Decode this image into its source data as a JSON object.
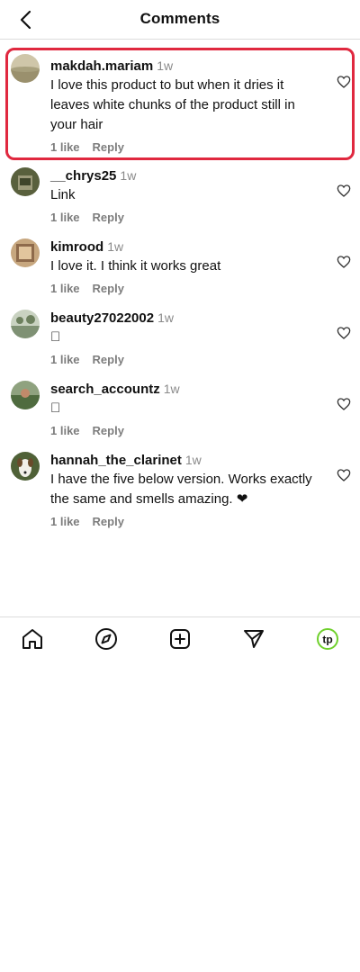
{
  "header": {
    "title": "Comments"
  },
  "comments": [
    {
      "username": "makdah.mariam",
      "time": "1w",
      "text": "I love this product to but when it dries it leaves white chunks of the product still in your hair",
      "likes": "1 like",
      "reply": "Reply",
      "highlighted": true,
      "avatar_color": "#b9ad8a"
    },
    {
      "username": "__chrys25",
      "time": "1w",
      "text": "Link",
      "likes": "1 like",
      "reply": "Reply",
      "avatar_color": "#6b6f4a"
    },
    {
      "username": "kimrood",
      "time": "1w",
      "text": "I love it. I think it works great",
      "likes": "1 like",
      "reply": "Reply",
      "avatar_color": "#b89474"
    },
    {
      "username": "beauty27022002",
      "time": "1w",
      "text": "\u0000",
      "likes": "1 like",
      "reply": "Reply",
      "avatar_color": "#9fae92"
    },
    {
      "username": "search_accountz",
      "time": "1w",
      "text": "\u0000",
      "likes": "1 like",
      "reply": "Reply",
      "avatar_color": "#6f8a63"
    },
    {
      "username": "hannah_the_clarinet",
      "time": "1w",
      "text": "I have the five below version. Works exactly the same and smells amazing. ❤",
      "likes": "1 like",
      "reply": "Reply",
      "avatar_color": "#5f7043"
    }
  ],
  "nav": {
    "items": [
      "home-icon",
      "explore-icon",
      "create-icon",
      "send-icon",
      "profile-icon"
    ],
    "profile_label": "tp",
    "accent_color": "#6fd02c"
  },
  "colors": {
    "highlight": "#e0283f",
    "meta_text": "#7d7d7d"
  }
}
